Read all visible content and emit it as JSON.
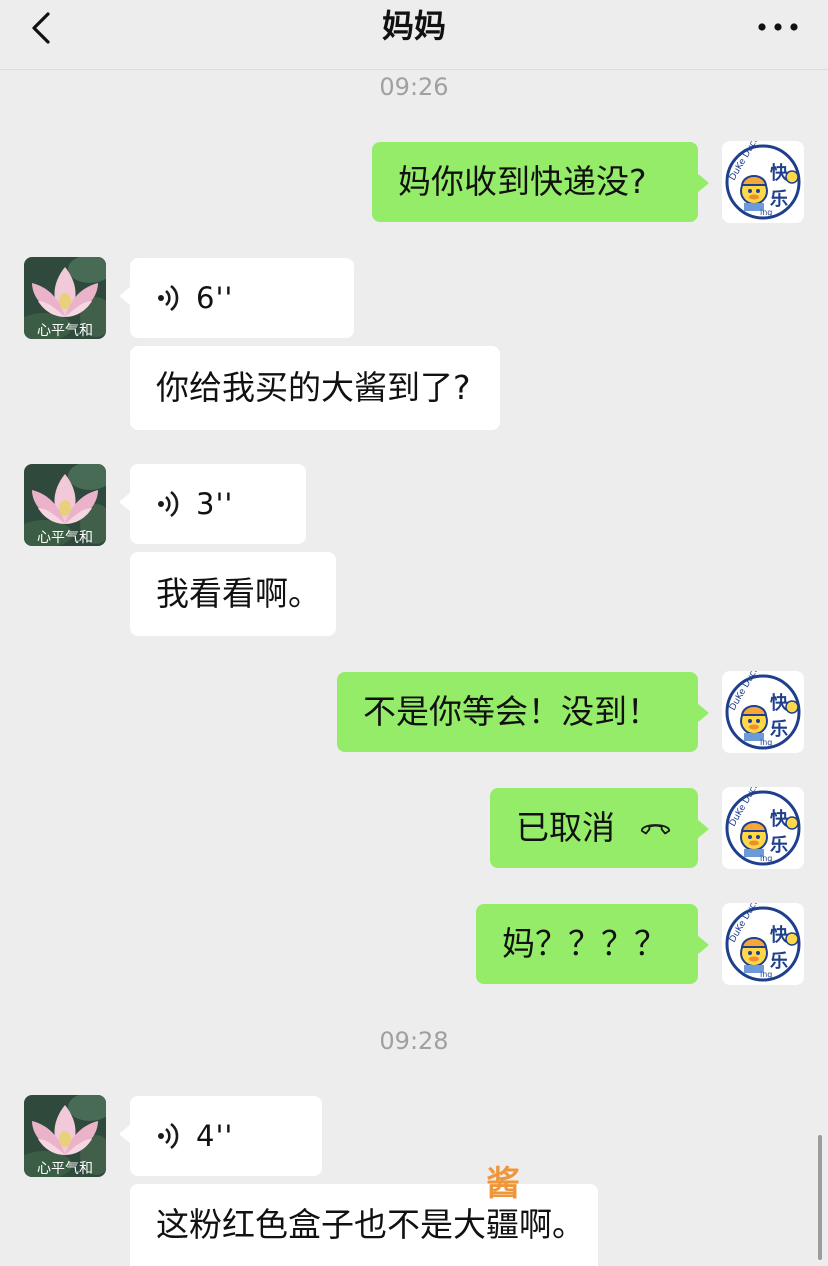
{
  "header": {
    "title": "妈妈",
    "back_icon": "chevron-left-icon",
    "more_icon": "more-dots-icon"
  },
  "contact_avatar": {
    "caption": "心平气和",
    "icon": "lotus-avatar"
  },
  "my_avatar": {
    "text_main": "快乐",
    "text_side": "DuKe Duck",
    "text_small": "ing",
    "icon": "duck-avatar"
  },
  "timestamps": [
    "09:26",
    "09:28"
  ],
  "messages": [
    {
      "from": "me",
      "type": "text",
      "text": "妈你收到快递没?"
    },
    {
      "from": "contact",
      "type": "voice",
      "duration": "6''",
      "transcript": "你给我买的大酱到了?"
    },
    {
      "from": "contact",
      "type": "voice",
      "duration": "3''",
      "transcript": "我看看啊。"
    },
    {
      "from": "me",
      "type": "text",
      "text": "不是你等会！没到！"
    },
    {
      "from": "me",
      "type": "call",
      "text": "已取消",
      "icon": "phone-hangup-icon"
    },
    {
      "from": "me",
      "type": "text",
      "text": "妈？？？？"
    },
    {
      "from": "contact",
      "type": "voice",
      "duration": "4''",
      "transcript": "这粉红色盒子也不是大疆啊。"
    }
  ],
  "overlay": {
    "watermark": "酱"
  },
  "colors": {
    "background": "#ededed",
    "my_bubble": "#95ec69",
    "their_bubble": "#ffffff",
    "timestamp": "#a0a0a0",
    "watermark": "#f0963a"
  }
}
